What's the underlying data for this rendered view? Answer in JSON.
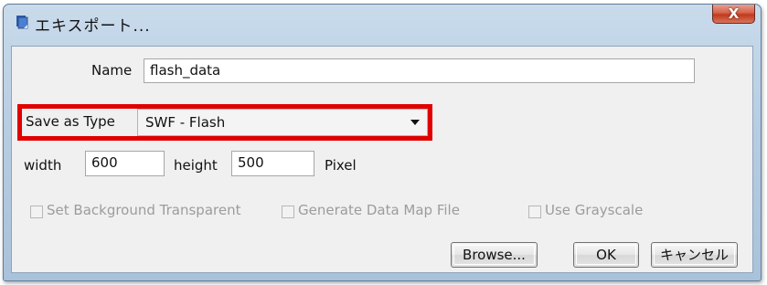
{
  "window": {
    "title": "エキスポート...",
    "close_label": "X"
  },
  "form": {
    "name_label": "Name",
    "name_value": "flash_data",
    "save_type_label": "Save as Type",
    "save_type_value": "SWF - Flash",
    "width_label": "width",
    "width_value": "600",
    "height_label": "height",
    "height_value": "500",
    "unit_label": "Pixel"
  },
  "options": {
    "transparent_label": "Set Background Transparent",
    "datamap_label": "Generate Data Map File",
    "grayscale_label": "Use Grayscale"
  },
  "buttons": {
    "browse_label": "Browse...",
    "ok_label": "OK",
    "cancel_label": "キャンセル"
  },
  "colors": {
    "highlight": "#e00000",
    "close_button": "#c03a1e"
  },
  "icons": {
    "app": "bookmark-icon",
    "close": "close-icon"
  }
}
